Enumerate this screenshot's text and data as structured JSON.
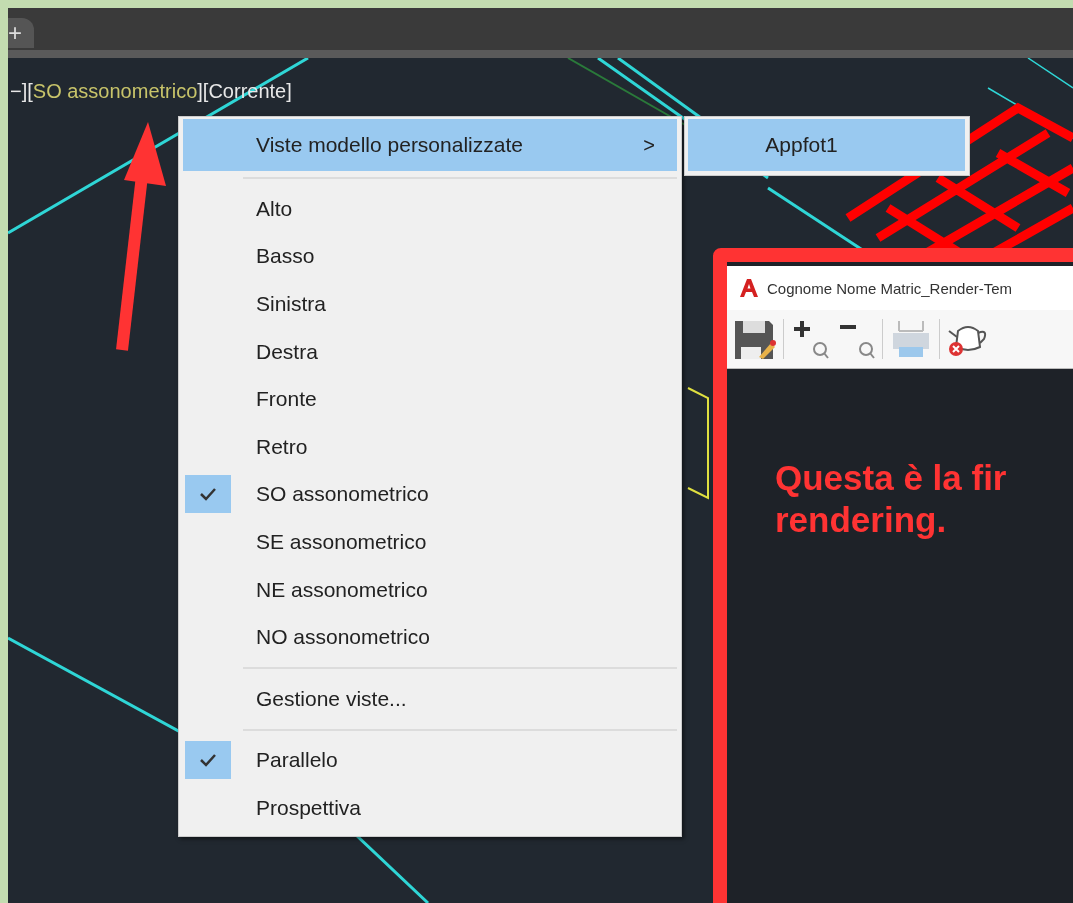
{
  "tab_bar": {
    "new_tab": "+"
  },
  "viewport_label": {
    "prefix": "−][",
    "view": "SO assonometrico",
    "suffix": "][Corrente]"
  },
  "context_menu": {
    "items": [
      {
        "kind": "submenu",
        "label": "Viste modello personalizzate",
        "arrow": ">",
        "highlighted": true,
        "checked": false
      },
      {
        "kind": "separator"
      },
      {
        "kind": "item",
        "label": "Alto",
        "highlighted": false,
        "checked": false
      },
      {
        "kind": "item",
        "label": "Basso",
        "highlighted": false,
        "checked": false
      },
      {
        "kind": "item",
        "label": "Sinistra",
        "highlighted": false,
        "checked": false
      },
      {
        "kind": "item",
        "label": "Destra",
        "highlighted": false,
        "checked": false
      },
      {
        "kind": "item",
        "label": "Fronte",
        "highlighted": false,
        "checked": false
      },
      {
        "kind": "item",
        "label": "Retro",
        "highlighted": false,
        "checked": false
      },
      {
        "kind": "item",
        "label": "SO assonometrico",
        "highlighted": false,
        "checked": true
      },
      {
        "kind": "item",
        "label": "SE assonometrico",
        "highlighted": false,
        "checked": false
      },
      {
        "kind": "item",
        "label": "NE assonometrico",
        "highlighted": false,
        "checked": false
      },
      {
        "kind": "item",
        "label": "NO assonometrico",
        "highlighted": false,
        "checked": false
      },
      {
        "kind": "separator"
      },
      {
        "kind": "item",
        "label": "Gestione viste...",
        "highlighted": false,
        "checked": false
      },
      {
        "kind": "separator"
      },
      {
        "kind": "item",
        "label": "Parallelo",
        "highlighted": false,
        "checked": true
      },
      {
        "kind": "item",
        "label": "Prospettiva",
        "highlighted": false,
        "checked": false
      }
    ]
  },
  "submenu": {
    "items": [
      {
        "label": "Appfot1",
        "highlighted": true
      }
    ]
  },
  "render_window": {
    "title": "Cognome Nome Matric_Render-Tem"
  },
  "annotation": {
    "lines": [
      "Questa è la fir",
      "rendering."
    ]
  }
}
